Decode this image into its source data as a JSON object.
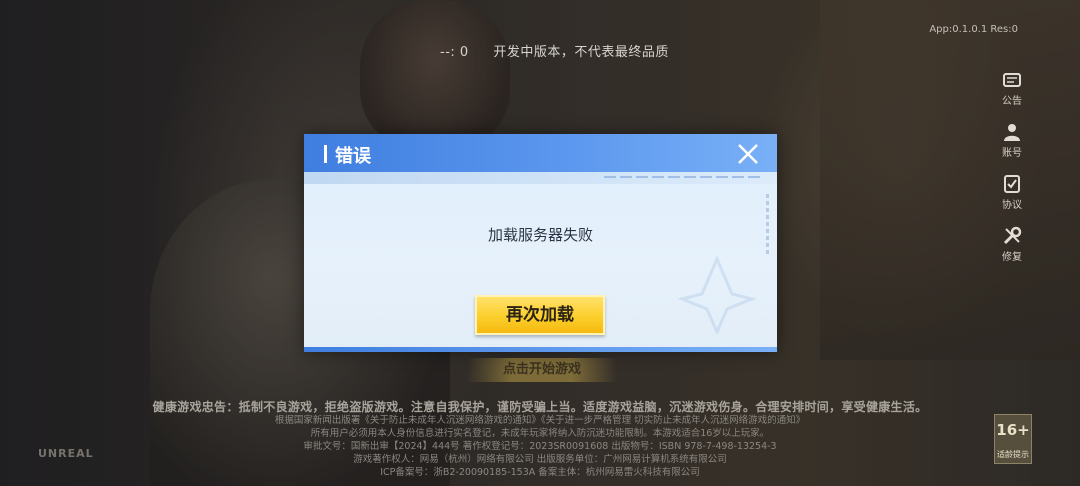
{
  "top": {
    "code": "--: 0",
    "notice": "开发中版本，不代表最终品质",
    "version": "App:0.1.0.1 Res:0"
  },
  "side_menu": [
    {
      "label": "公告",
      "icon": "notice-icon"
    },
    {
      "label": "账号",
      "icon": "account-icon"
    },
    {
      "label": "协议",
      "icon": "agreement-icon"
    },
    {
      "label": "修复",
      "icon": "repair-icon"
    }
  ],
  "modal": {
    "title": "错误",
    "message": "加载服务器失败",
    "retry_label": "再次加载",
    "close_icon": "close-icon",
    "header_color": "#3f7ee0",
    "button_color": "#fccf2c"
  },
  "start_label": "点击开始游戏",
  "health_notice": "健康游戏忠告：抵制不良游戏，拒绝盗版游戏。注意自我保护，谨防受骗上当。适度游戏益脑，沉迷游戏伤身。合理安排时间，享受健康生活。",
  "legal_lines": [
    "根据国家新闻出版署《关于防止未成年人沉迷网络游戏的通知》《关于进一步严格管理 切实防止未成年人沉迷网络游戏的通知》",
    "所有用户必须用本人身份信息进行实名登记，未成年玩家将纳入防沉迷功能限制。本游戏适合16岁以上玩家。",
    "审批文号：国新出审【2024】444号 著作权登记号：2023SR0091608 出版物号：ISBN 978-7-498-13254-3",
    "游戏著作权人：网易（杭州）网络有限公司 出版服务单位：广州网易计算机系统有限公司",
    "ICP备案号：浙B2-20090185-153A 备案主体：杭州网易雷火科技有限公司"
  ],
  "studio_logo": "UNREAL",
  "age_rating": {
    "number": "16+",
    "caption": "适龄提示"
  }
}
